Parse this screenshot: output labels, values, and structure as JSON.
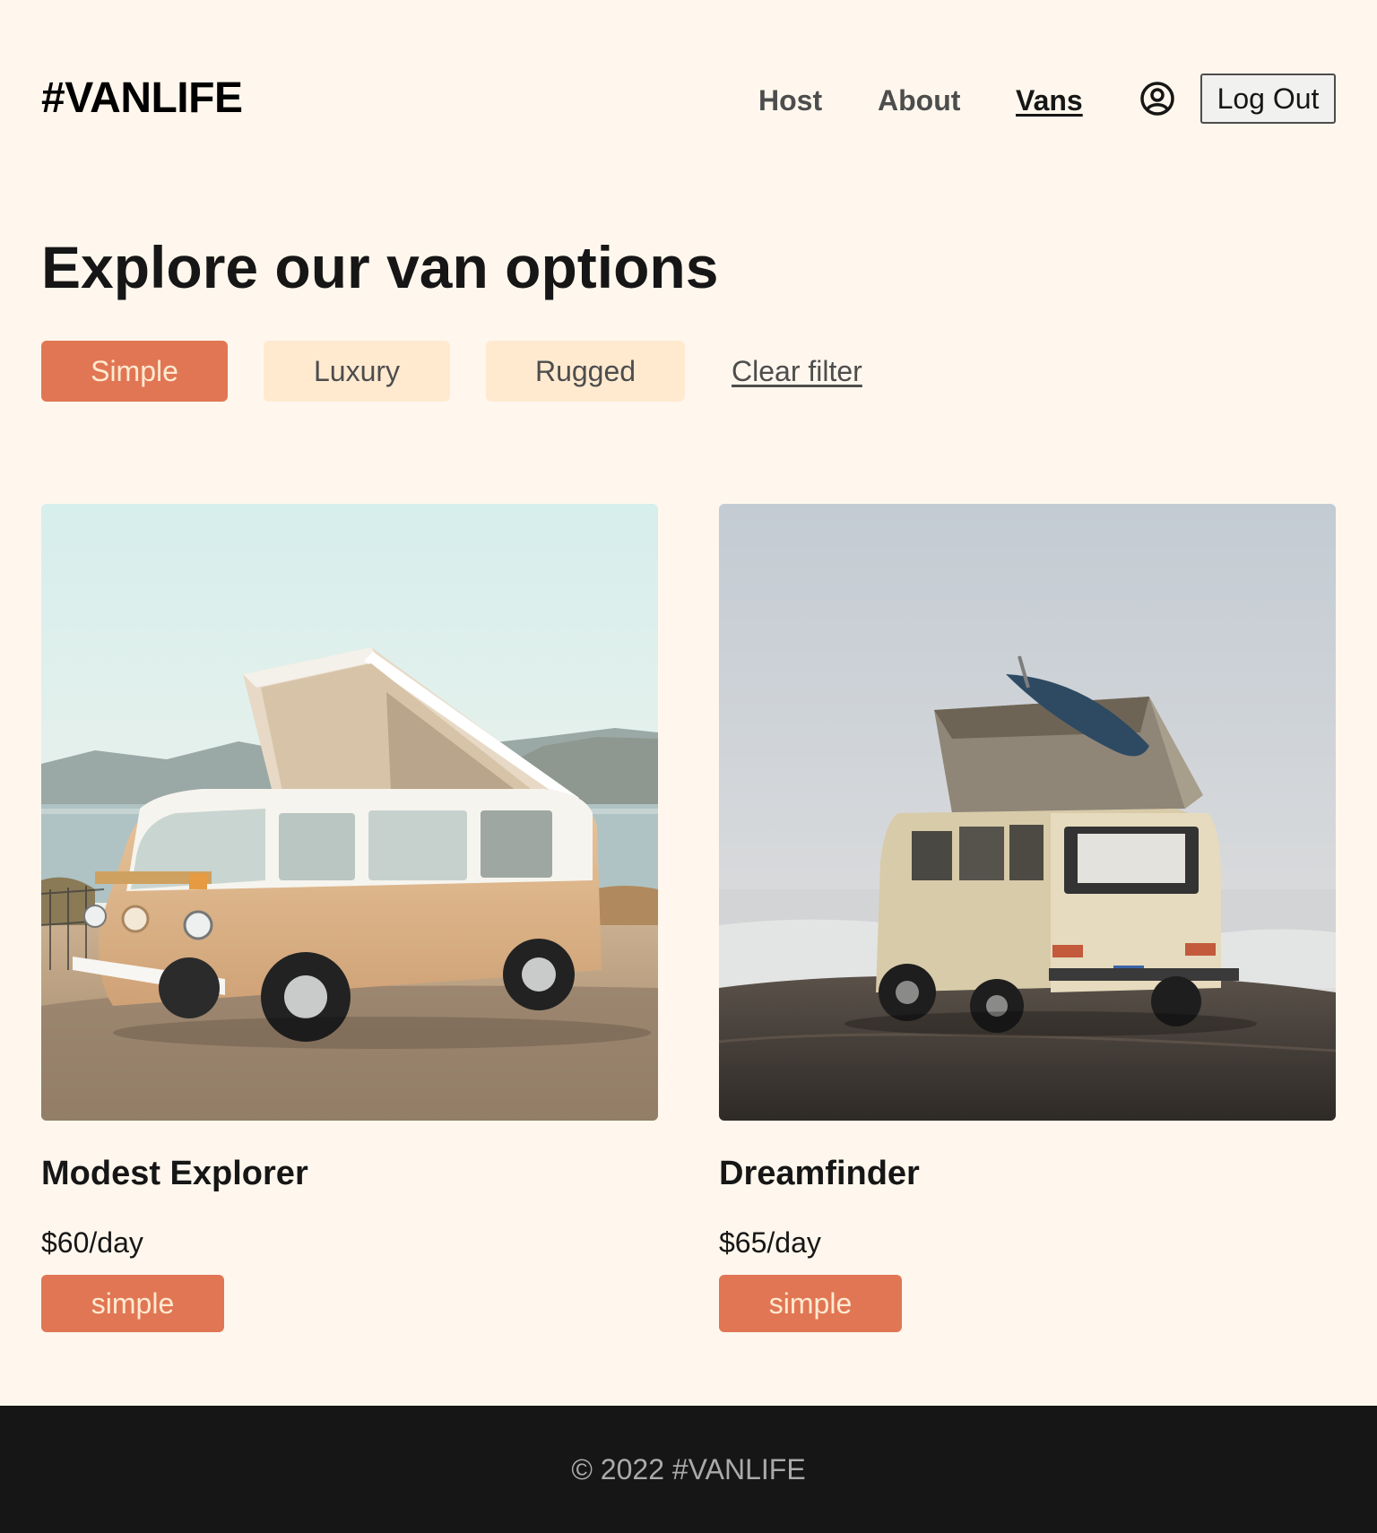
{
  "header": {
    "logo": "#VANLIFE",
    "nav": [
      {
        "label": "Host"
      },
      {
        "label": "About"
      },
      {
        "label": "Vans"
      }
    ],
    "active_nav": "Vans",
    "user_icon": "user-circle-icon",
    "logout_label": "Log Out"
  },
  "main": {
    "title": "Explore our van options",
    "filters": [
      {
        "label": "Simple",
        "selected": true
      },
      {
        "label": "Luxury",
        "selected": false
      },
      {
        "label": "Rugged",
        "selected": false
      }
    ],
    "clear_filter_label": "Clear filter",
    "vans": [
      {
        "name": "Modest Explorer",
        "price": "$60/day",
        "type": "simple"
      },
      {
        "name": "Dreamfinder",
        "price": "$65/day",
        "type": "simple"
      }
    ]
  },
  "footer": {
    "text": "© 2022 #VANLIFE"
  },
  "colors": {
    "background": "#FFF7ED",
    "accent": "#E17654",
    "filter_inactive": "#FFEAD0",
    "footer": "#161616"
  }
}
